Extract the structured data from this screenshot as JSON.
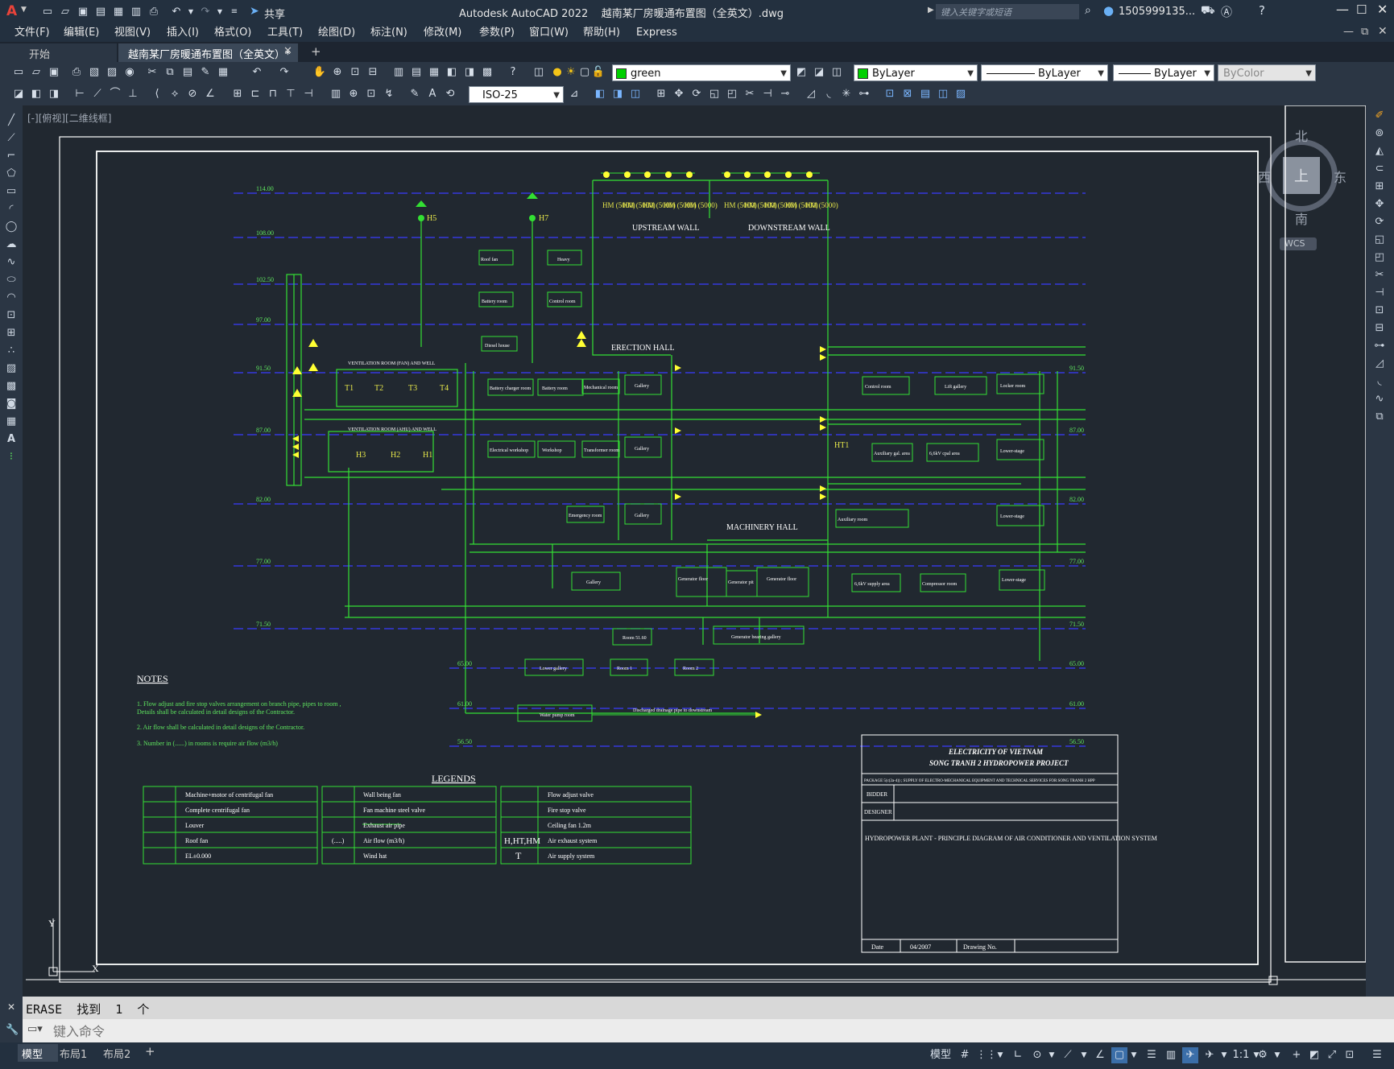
{
  "app": {
    "title": "Autodesk AutoCAD 2022    越南某厂房暖通布置图（全英文）.dwg",
    "share_label": "共享",
    "search_placeholder": "键入关键字或短语",
    "user": "1505999135...",
    "logo": "A"
  },
  "menu": {
    "items": [
      "文件(F)",
      "编辑(E)",
      "视图(V)",
      "插入(I)",
      "格式(O)",
      "工具(T)",
      "绘图(D)",
      "标注(N)",
      "修改(M)",
      "参数(P)",
      "窗口(W)",
      "帮助(H)",
      "Express"
    ]
  },
  "tabs": {
    "start": "开始",
    "active": "越南某厂房暖通布置图（全英文）*",
    "add": "+"
  },
  "toolbar": {
    "layer": "green",
    "color": "ByLayer",
    "linetype": "ByLayer",
    "lineweight": "ByLayer",
    "plotstyle": "ByColor",
    "dimstyle": "ISO-25",
    "accent_green": "#00d000"
  },
  "viewport": {
    "label": "[-][俯视][二维线框]"
  },
  "viewcube": {
    "north": "北",
    "south": "南",
    "east": "东",
    "west": "西",
    "top": "上",
    "wcs": "WCS"
  },
  "drawing": {
    "areas": {
      "upstream_wall": "UPSTREAM WALL",
      "downstream_wall": "DOWNSTREAM WALL",
      "erection_hall": "ERECTION HALL",
      "machinery_hall": "MACHINERY HALL",
      "ventilation": "VENTILATION ROOM (FAN) AND WELL",
      "ventilation2": "VENTILATION ROOM (AHU) AND WELL"
    },
    "hm_units": [
      "HM (5000)",
      "HM (5000)",
      "HM (5000)",
      "HM (5000)",
      "HM (5000)",
      "HM (5000)",
      "HM (5000)",
      "HM (5000)",
      "HM (5000)",
      "HM (5000)"
    ],
    "elev_labels": [
      "114.00",
      "108.00",
      "102.50",
      "97.00",
      "91.50",
      "87.00",
      "82.00",
      "77.00",
      "71.50",
      "65.00",
      "61.00",
      "56.50"
    ],
    "markers": {
      "h5": "H5",
      "h7": "H7",
      "t1": "T1",
      "t2": "T2",
      "t3": "T3",
      "t4": "T4",
      "h3": "H3",
      "h2": "H2",
      "h1": "H1",
      "ht1": "HT1"
    },
    "rooms": [
      "Roof fan",
      "Battery room",
      "Heavy",
      "Control room",
      "Diesel house",
      "Battery charger room",
      "Battery room",
      "Mechanical room",
      "Gallery",
      "Control room",
      "Lift gallery",
      "Locker room",
      "Auxiliary room",
      "Electrical workshop",
      "Workshop",
      "Transformer room",
      "Gallery",
      "Auxiliary gal. area",
      "6,6kV cpal area",
      "Lower-stage",
      "Emergency room",
      "Gallery",
      "Lower-stage",
      "Gallery",
      "Generator floor",
      "Generator pit",
      "Generator floor",
      "6,6kV supply area",
      "Compressor room",
      "Lower-stage",
      "Room 51.60",
      "Generator bearing gallery",
      "Lower gallery",
      "Room 1",
      "Room 2",
      "Water pump room",
      "Discharged drainage pipe to downstream"
    ],
    "notes": {
      "title": "NOTES",
      "lines": [
        "1. Flow adjust and fire stop valves arrangement on branch pipe, pipes to room ,",
        "Details shall be calculated in detail designs of the Contractor.",
        "2. Air flow shall be calculated in detail designs of the Contractor.",
        "3. Number in (......) in rooms is require air flow (m3/h)"
      ]
    },
    "legends": {
      "title": "LEGENDS",
      "col1": [
        "Machine+motor of centrifugal fan",
        "Complete centrifugal fan",
        "Louver",
        "Roof fan",
        "EL±0.000"
      ],
      "col2": [
        "Wall being fan",
        "Fan machine steel valve",
        "Exhaust air pipe",
        "Air flow (m3/h)",
        "Wind hat"
      ],
      "col2_symbol": "(.....)",
      "col3": [
        "Flow adjust valve",
        "Fire stop valve",
        "Ceiling fan 1.2m",
        "Air exhaust system",
        "Air supply system"
      ],
      "col3_symbols": [
        "H,HT,HM",
        "T"
      ]
    },
    "titleblock": {
      "company": "ELECTRICITY OF VIETNAM",
      "project": "SONG TRANH 2 HYDROPOWER PROJECT",
      "package": "PACKAGE 5(c(2a-4)) ; SUPPLY OF ELECTRO-MECHANICAL EQUIPMENT AND TECHNICAL SERVICES FOR SONG TRANH 2 HPP",
      "bidder": "BIDDER",
      "designer": "DESIGNER",
      "drawing_title": "HYDROPOWER PLANT - PRINCIPLE DIAGRAM OF AIR CONDITIONER AND VENTILATION SYSTEM",
      "date_label": "Date",
      "date": "04/2007",
      "drawing_no_label": "Drawing No."
    }
  },
  "command": {
    "history": "ERASE  找到  1  个",
    "placeholder": "键入命令"
  },
  "status": {
    "tabs": [
      "模型",
      "布局1",
      "布局2"
    ],
    "model_label": "模型",
    "scale": "1:1"
  }
}
